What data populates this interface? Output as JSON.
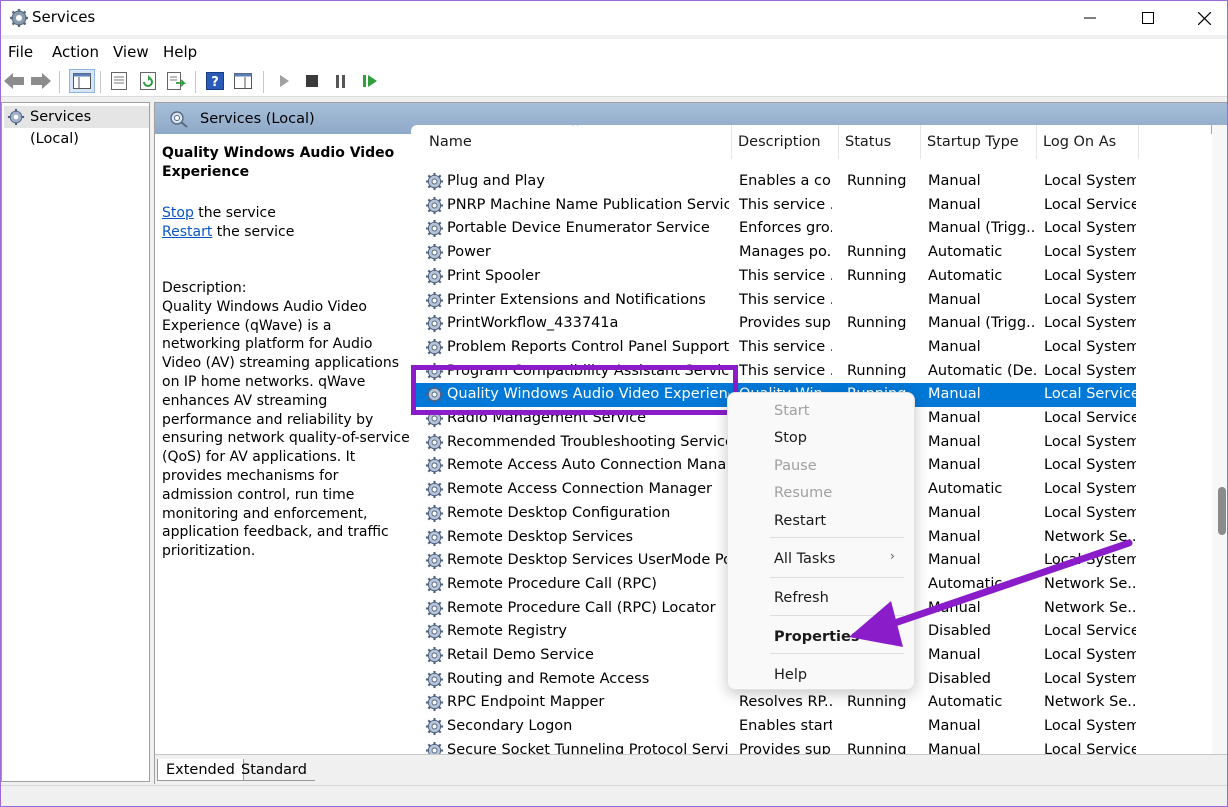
{
  "window": {
    "title": "Services"
  },
  "menu": [
    "File",
    "Action",
    "View",
    "Help"
  ],
  "tree": {
    "root": "Services (Local)"
  },
  "main": {
    "header": "Services (Local)",
    "selected_title": "Quality Windows Audio Video Experience",
    "stop_link": "Stop",
    "stop_suffix": " the service",
    "restart_link": "Restart",
    "restart_suffix": " the service",
    "description_label": "Description:",
    "description": "Quality Windows Audio Video Experience (qWave) is a networking platform for Audio Video (AV) streaming applications on IP home networks. qWave enhances AV streaming performance and reliability by ensuring network quality-of-service (QoS) for AV applications. It provides mechanisms for admission control, run time monitoring and enforcement, application feedback, and traffic prioritization."
  },
  "columns": [
    "Name",
    "Description",
    "Status",
    "Startup Type",
    "Log On As"
  ],
  "rows": [
    {
      "name": "Plug and Play",
      "desc": "Enables a co...",
      "status": "Running",
      "startup": "Manual",
      "logon": "Local System"
    },
    {
      "name": "PNRP Machine Name Publication Service",
      "desc": "This service ...",
      "status": "",
      "startup": "Manual",
      "logon": "Local Service"
    },
    {
      "name": "Portable Device Enumerator Service",
      "desc": "Enforces gro...",
      "status": "",
      "startup": "Manual (Trigg...",
      "logon": "Local System"
    },
    {
      "name": "Power",
      "desc": "Manages po...",
      "status": "Running",
      "startup": "Automatic",
      "logon": "Local System"
    },
    {
      "name": "Print Spooler",
      "desc": "This service ...",
      "status": "Running",
      "startup": "Automatic",
      "logon": "Local System"
    },
    {
      "name": "Printer Extensions and Notifications",
      "desc": "This service ...",
      "status": "",
      "startup": "Manual",
      "logon": "Local System"
    },
    {
      "name": "PrintWorkflow_433741a",
      "desc": "Provides sup...",
      "status": "Running",
      "startup": "Manual (Trigg...",
      "logon": "Local System"
    },
    {
      "name": "Problem Reports Control Panel Support",
      "desc": "This service ...",
      "status": "",
      "startup": "Manual",
      "logon": "Local System"
    },
    {
      "name": "Program Compatibility Assistant Service",
      "desc": "This service ...",
      "status": "Running",
      "startup": "Automatic (De...",
      "logon": "Local System"
    },
    {
      "name": "Quality Windows Audio Video Experience",
      "desc": "Quality Win...",
      "status": "Running",
      "startup": "Manual",
      "logon": "Local Service"
    },
    {
      "name": "Radio Management Service",
      "desc": "",
      "status": "",
      "startup": "Manual",
      "logon": "Local Service"
    },
    {
      "name": "Recommended Troubleshooting Service",
      "desc": "",
      "status": "",
      "startup": "Manual",
      "logon": "Local System"
    },
    {
      "name": "Remote Access Auto Connection Manager",
      "desc": "",
      "status": "",
      "startup": "Manual",
      "logon": "Local System"
    },
    {
      "name": "Remote Access Connection Manager",
      "desc": "",
      "status": "",
      "startup": "Automatic",
      "logon": "Local System"
    },
    {
      "name": "Remote Desktop Configuration",
      "desc": "",
      "status": "",
      "startup": "Manual",
      "logon": "Local System"
    },
    {
      "name": "Remote Desktop Services",
      "desc": "",
      "status": "",
      "startup": "Manual",
      "logon": "Network Se..."
    },
    {
      "name": "Remote Desktop Services UserMode Port ...",
      "desc": "",
      "status": "",
      "startup": "Manual",
      "logon": "Local System"
    },
    {
      "name": "Remote Procedure Call (RPC)",
      "desc": "",
      "status": "",
      "startup": "Automatic",
      "logon": "Network Se..."
    },
    {
      "name": "Remote Procedure Call (RPC) Locator",
      "desc": "",
      "status": "",
      "startup": "Manual",
      "logon": "Network Se..."
    },
    {
      "name": "Remote Registry",
      "desc": "",
      "status": "",
      "startup": "Disabled",
      "logon": "Local Service"
    },
    {
      "name": "Retail Demo Service",
      "desc": "",
      "status": "",
      "startup": "Manual",
      "logon": "Local System"
    },
    {
      "name": "Routing and Remote Access",
      "desc": "",
      "status": "",
      "startup": "Disabled",
      "logon": "Local System"
    },
    {
      "name": "RPC Endpoint Mapper",
      "desc": "Resolves RP...",
      "status": "Running",
      "startup": "Automatic",
      "logon": "Network Se..."
    },
    {
      "name": "Secondary Logon",
      "desc": "Enables start...",
      "status": "",
      "startup": "Manual",
      "logon": "Local System"
    },
    {
      "name": "Secure Socket Tunneling Protocol Service",
      "desc": "Provides sup...",
      "status": "Running",
      "startup": "Manual",
      "logon": "Local Service"
    }
  ],
  "selected_row": 9,
  "context_menu": {
    "items": [
      {
        "label": "Start",
        "disabled": true
      },
      {
        "label": "Stop",
        "disabled": false
      },
      {
        "label": "Pause",
        "disabled": true
      },
      {
        "label": "Resume",
        "disabled": true
      },
      {
        "label": "Restart",
        "disabled": false
      },
      {
        "label": "All Tasks",
        "disabled": false
      },
      {
        "label": "Refresh",
        "disabled": false
      },
      {
        "label": "Properties",
        "disabled": false,
        "bold": true
      },
      {
        "label": "Help",
        "disabled": false
      }
    ]
  },
  "tabs": [
    "Extended",
    "Standard"
  ],
  "colors": {
    "selection": "#0078d7",
    "highlight": "#8a1cc9",
    "link": "#0a55c8"
  }
}
